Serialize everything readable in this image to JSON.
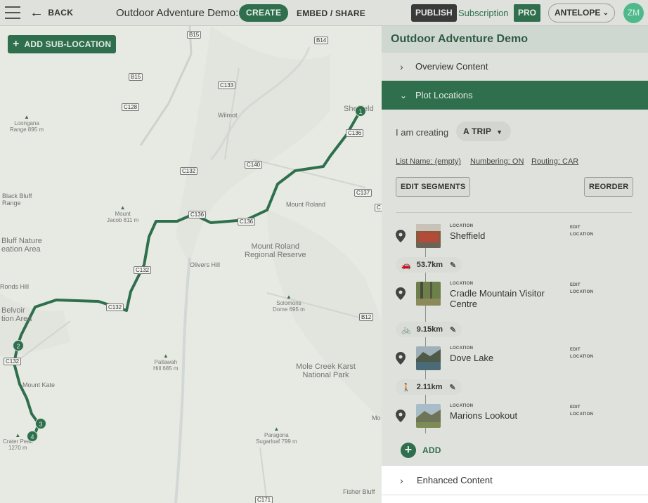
{
  "topbar": {
    "back_label": "BACK",
    "title": "Outdoor Adventure Demo:",
    "create_label": "CREATE",
    "embed_label": "EMBED / SHARE",
    "publish_label": "PUBLISH",
    "subscription_label": "Subscription",
    "pro_label": "PRO",
    "account_label": "ANTELOPE",
    "avatar_initials": "ZM"
  },
  "map": {
    "add_sub_location_label": "ADD SUB-LOCATION",
    "route_color": "#2f6f4d",
    "roads": [
      "B15",
      "B14",
      "B15",
      "C133",
      "C128",
      "C136",
      "C140",
      "C132",
      "C137",
      "C136",
      "C136",
      "C132",
      "C132",
      "B12",
      "C132",
      "C171",
      "C"
    ],
    "places": {
      "loongana": "Loongana\nRange 895 m",
      "wilmot": "Wilmot",
      "sheffield": "Sheffield",
      "black_bluff": "Black Bluff\nRange",
      "mount_jacob": "Mount\nJacob 811 m",
      "mount_roland": "Mount Roland",
      "bluff_nature": "Bluff Nature\neation Area",
      "mount_roland_reserve": "Mount Roland\nRegional Reserve",
      "olivers_hill": "Olivers Hill",
      "ronds_hill": "Ronds Hill",
      "belvoir": "Belvoir\ntion Area",
      "solomons": "Solomons\nDome 695 m",
      "pallawah": "Pallawah\nHill 685 m",
      "mole_creek": "Mole Creek Karst\nNational Park",
      "mount_kate": "Mount Kate",
      "crater_peak": "Crater Peak\n1270 m",
      "paragona": "Paragona\nSugarloaf 799 m",
      "fisher_bluff": "Fisher Bluff",
      "mc": "Mo"
    },
    "markers": [
      "1",
      "2",
      "3",
      "4"
    ]
  },
  "panel": {
    "title": "Outdoor Adventure Demo",
    "overview_label": "Overview Content",
    "plot_locations_label": "Plot Locations",
    "creating_label": "I am creating",
    "trip_value": "A TRIP",
    "list_name": "List Name: (empty)",
    "numbering": "Numbering: ON",
    "routing": "Routing: CAR",
    "edit_segments_label": "EDIT SEGMENTS",
    "reorder_label": "REORDER",
    "location_caption": "LOCATION",
    "edit_caption_1": "EDIT",
    "edit_caption_2": "LOCATION",
    "locations": [
      {
        "name": "Sheffield"
      },
      {
        "name": "Cradle Mountain Visitor Centre"
      },
      {
        "name": "Dove Lake"
      },
      {
        "name": "Marions Lookout"
      }
    ],
    "segments": [
      {
        "distance": "53.7km",
        "mode": "car-icon"
      },
      {
        "distance": "9.15km",
        "mode": "bicycle-icon"
      },
      {
        "distance": "2.11km",
        "mode": "hiking-icon"
      }
    ],
    "add_label": "ADD",
    "enhanced_label": "Enhanced Content"
  }
}
